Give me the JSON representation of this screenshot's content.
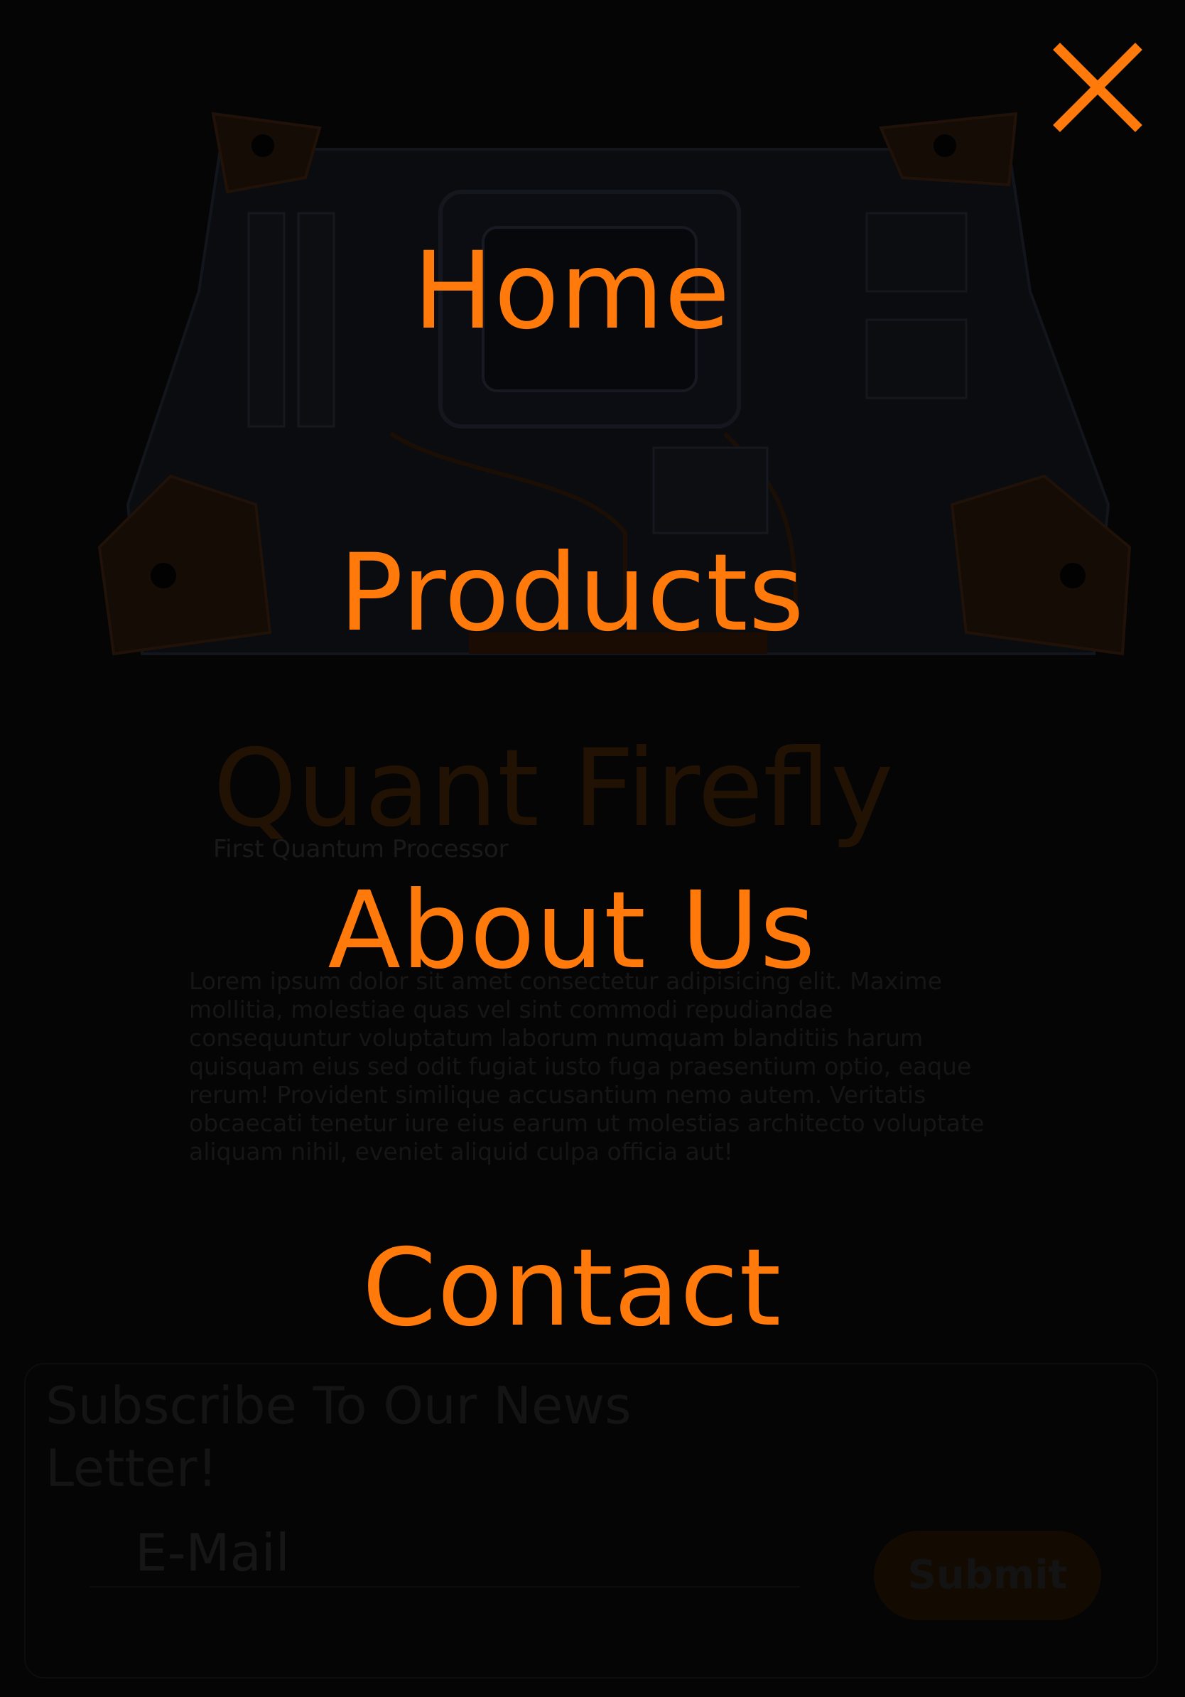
{
  "menu": {
    "items": [
      {
        "label": "Home"
      },
      {
        "label": "Products"
      },
      {
        "label": "About Us"
      },
      {
        "label": "Contact"
      }
    ],
    "close_icon": "close-icon",
    "accent_color": "#ff7a0a"
  },
  "product": {
    "title": "Quant Firefly",
    "subtitle": "First Quantum Processor",
    "description": "Lorem ipsum dolor sit amet consectetur adipisicing elit. Maxime mollitia, molestiae quas vel sint commodi repudiandae consequuntur voluptatum laborum numquam blanditiis harum quisquam eius sed odit fugiat iusto fuga praesentium optio, eaque rerum! Provident similique accusantium nemo autem. Veritatis obcaecati tenetur iure eius earum ut molestias architecto voluptate aliquam nihil, eveniet aliquid culpa officia aut!"
  },
  "newsletter": {
    "title": "Subscribe To Our News Letter!",
    "email_placeholder": "E-Mail",
    "submit_label": "Submit"
  }
}
